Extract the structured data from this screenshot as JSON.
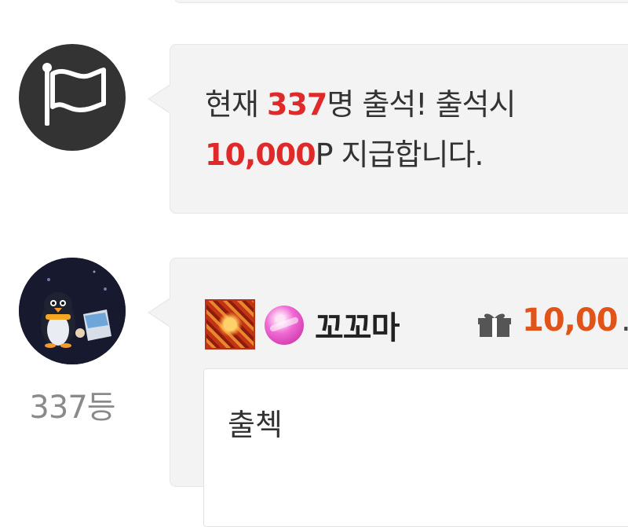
{
  "notice": {
    "prefix": "현재 ",
    "count": "337",
    "mid": "명 출석! 출석시",
    "points": "10,000",
    "suffix": "P 지급합니다.",
    "icon": "flag-icon"
  },
  "post": {
    "rank": "337등",
    "nickname": "꼬꼬마",
    "points": "10,00",
    "ellipsis": "...",
    "comment": "출첵",
    "icons": [
      "level-badge-icon",
      "gem-icon",
      "gift-icon"
    ]
  },
  "colors": {
    "highlight": "#e02a2a",
    "points": "#e0541a",
    "bubble_bg": "#f3f3f3"
  }
}
